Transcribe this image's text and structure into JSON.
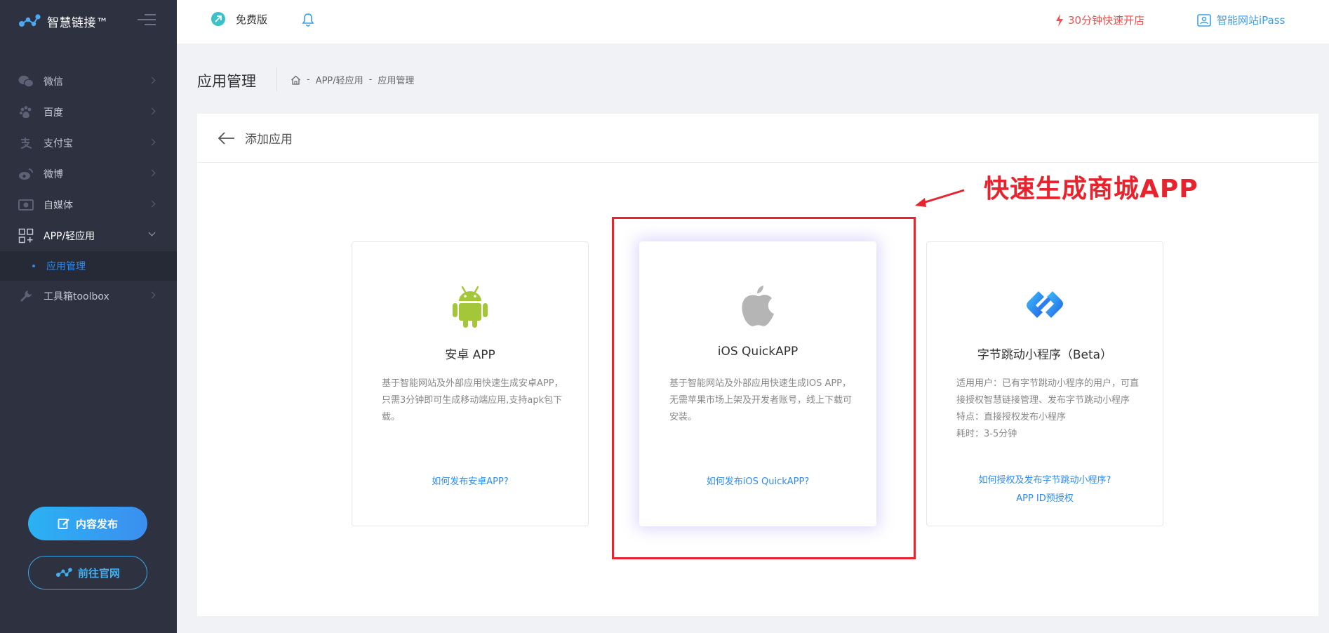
{
  "app": {
    "name": "智慧链接™"
  },
  "sidebar": {
    "items": [
      {
        "label": "微信",
        "icon": "wechat-icon"
      },
      {
        "label": "百度",
        "icon": "baidu-paw-icon"
      },
      {
        "label": "支付宝",
        "icon": "alipay-icon"
      },
      {
        "label": "微博",
        "icon": "weibo-icon"
      },
      {
        "label": "自媒体",
        "icon": "media-icon"
      },
      {
        "label": "APP/轻应用",
        "icon": "apps-grid-icon"
      },
      {
        "label": "工具箱toolbox",
        "icon": "wrench-icon"
      }
    ],
    "active_sub": "应用管理",
    "publish_button": "内容发布",
    "official_button": "前往官网"
  },
  "header": {
    "plan": "免费版",
    "quick_open": "30分钟快速开店",
    "ipass": "智能网站iPass"
  },
  "page": {
    "title": "应用管理",
    "breadcrumb": [
      "APP/轻应用",
      "应用管理"
    ],
    "back_label": "添加应用"
  },
  "apps": [
    {
      "name": "安卓 APP",
      "icon": "android-icon",
      "desc": "基于智能网站及外部应用快速生成安卓APP，只需3分钟即可生成移动端应用,支持apk包下载。",
      "links": [
        "如何发布安卓APP?"
      ]
    },
    {
      "name": "iOS QuickAPP",
      "icon": "apple-icon",
      "desc": "基于智能网站及外部应用快速生成IOS APP，无需苹果市场上架及开发者账号，线上下载可安装。",
      "links": [
        "如何发布iOS QuickAPP?"
      ]
    },
    {
      "name": "字节跳动小程序（Beta）",
      "icon": "bytedance-icon",
      "desc_lines": [
        "适用用户：已有字节跳动小程序的用户，可直接授权智慧链接管理、发布字节跳动小程序",
        "特点：直接授权发布小程序",
        "耗时：3-5分钟"
      ],
      "links": [
        "如何授权及发布字节跳动小程序?",
        "APP ID预授权"
      ]
    }
  ],
  "annotation": {
    "text": "快速生成商城APP"
  },
  "colors": {
    "sidebar_bg": "#2e3140",
    "accent_blue": "#2d8cf0",
    "annotation_red": "#e8232d",
    "android_green": "#a4c639"
  }
}
